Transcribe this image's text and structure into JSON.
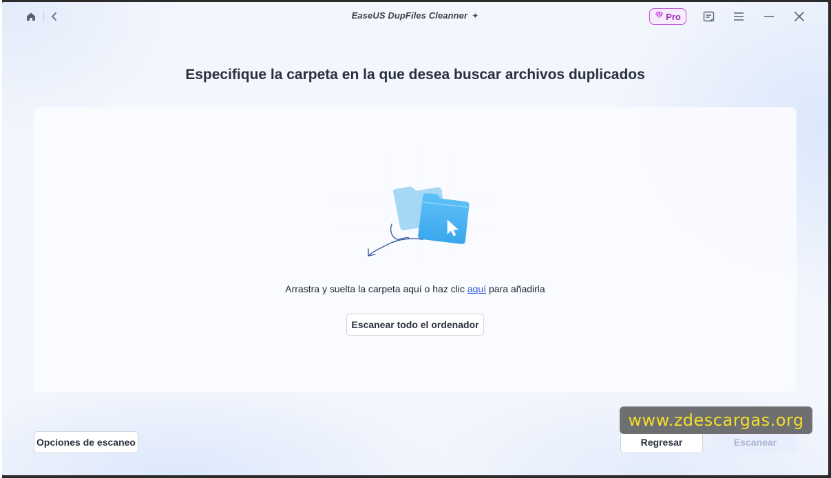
{
  "titlebar": {
    "app_title": "EaseUS DupFiles Cleanner",
    "pro_label": "Pro",
    "icons": [
      "home-icon",
      "back-chevron-icon",
      "sparkle-icon",
      "diamond-icon",
      "feedback-icon",
      "menu-icon",
      "minimize-icon",
      "close-icon"
    ]
  },
  "main": {
    "heading": "Especifique la carpeta en la que desea buscar archivos duplicados",
    "drop_text_before": "Arrastra y suelta la carpeta aquí o haz clic ",
    "drop_text_link": "aquí",
    "drop_text_after": " para añadirla",
    "scan_all_label": "Escanear todo el ordenador"
  },
  "footer": {
    "options_label": "Opciones de escaneo",
    "back_label": "Regresar",
    "scan_label": "Escanear"
  },
  "watermark": "www.zdescargas.org",
  "colors": {
    "accent_link": "#2c5dd6",
    "pro_border": "#c04ad8",
    "folder_front": "#4eb6f4",
    "folder_back": "#a6d8f6",
    "watermark_text": "#f5de2a"
  }
}
